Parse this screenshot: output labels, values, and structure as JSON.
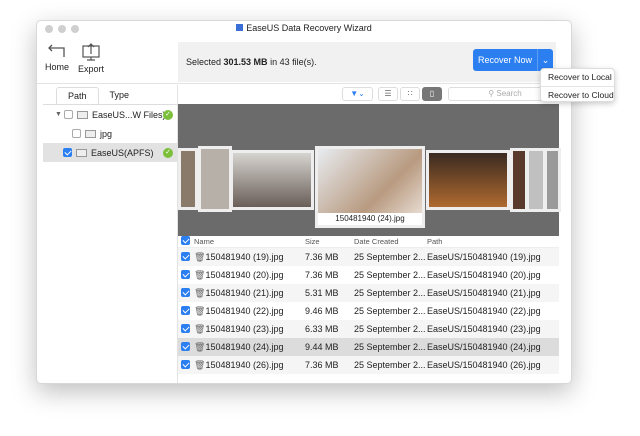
{
  "window": {
    "title": "EaseUS Data Recovery Wizard"
  },
  "toolbar": {
    "home": "Home",
    "export": "Export"
  },
  "selection": {
    "prefix": "Selected ",
    "size": "301.53 MB",
    "middle": " in ",
    "count": "43 file(s)",
    "suffix": "."
  },
  "recover": {
    "label": "Recover Now",
    "menu": [
      "Recover to Local",
      "Recover to Cloud"
    ]
  },
  "sidebar": {
    "tabs": [
      "Path",
      "Type"
    ],
    "tree": [
      {
        "label": "EaseUS...W Files)",
        "checked": false
      },
      {
        "label": "jpg",
        "checked": false
      },
      {
        "label": "EaseUS(APFS)",
        "checked": true
      }
    ]
  },
  "view": {
    "search_placeholder": "Search"
  },
  "preview": {
    "caption": "150481940 (24).jpg"
  },
  "table": {
    "columns": [
      "Name",
      "Size",
      "Date Created",
      "Path"
    ],
    "rows": [
      {
        "name": "150481940 (19).jpg",
        "size": "7.36 MB",
        "date": "25 September 2...",
        "path": "EaseUS/150481940 (19).jpg"
      },
      {
        "name": "150481940 (20).jpg",
        "size": "7.36 MB",
        "date": "25 September 2...",
        "path": "EaseUS/150481940 (20).jpg"
      },
      {
        "name": "150481940 (21).jpg",
        "size": "5.31 MB",
        "date": "25 September 2...",
        "path": "EaseUS/150481940 (21).jpg"
      },
      {
        "name": "150481940 (22).jpg",
        "size": "9.46 MB",
        "date": "25 September 2...",
        "path": "EaseUS/150481940 (22).jpg"
      },
      {
        "name": "150481940 (23).jpg",
        "size": "6.33 MB",
        "date": "25 September 2...",
        "path": "EaseUS/150481940 (23).jpg"
      },
      {
        "name": "150481940 (24).jpg",
        "size": "9.44 MB",
        "date": "25 September 2...",
        "path": "EaseUS/150481940 (24).jpg"
      },
      {
        "name": "150481940 (26).jpg",
        "size": "7.36 MB",
        "date": "25 September 2...",
        "path": "EaseUS/150481940 (26).jpg"
      }
    ]
  },
  "colors": {
    "accent": "#2b7ff0",
    "ok": "#7cbf3a"
  }
}
